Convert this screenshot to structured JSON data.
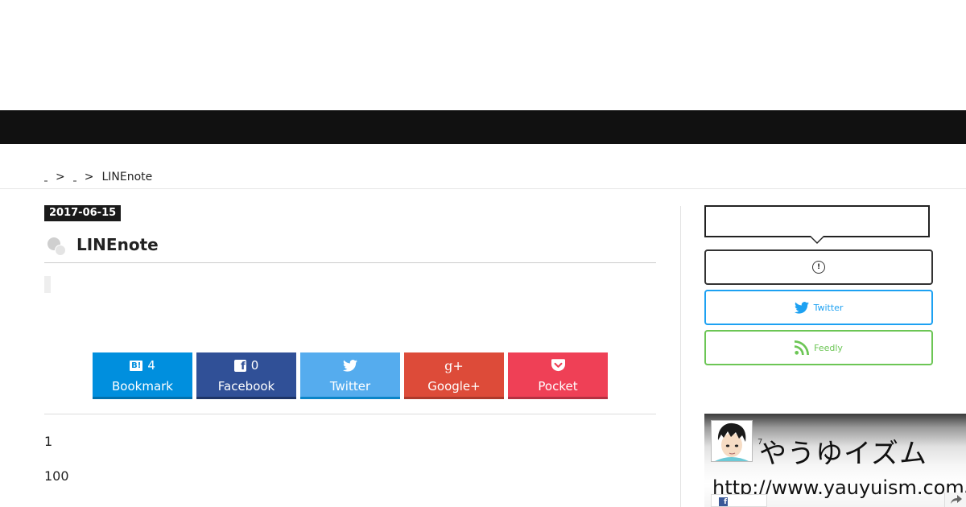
{
  "breadcrumb": {
    "separator": ">",
    "current": "LINEnote"
  },
  "post": {
    "date": "2017-06-15",
    "title": "LINEnote",
    "paragraphs": [
      "1",
      "100"
    ]
  },
  "share": {
    "hatena": {
      "badge": "B!",
      "count": "4",
      "label": "Bookmark",
      "color": "#008fde"
    },
    "facebook": {
      "badge": "f",
      "count": "0",
      "label": "Facebook",
      "color": "#305097"
    },
    "twitter": {
      "label": "Twitter",
      "color": "#55acee"
    },
    "gplus": {
      "badge": "g+",
      "label": "Google+",
      "color": "#dd4b39"
    },
    "pocket": {
      "label": "Pocket",
      "color": "#ef4056"
    }
  },
  "sidebar": {
    "follow_twitter": "Twitter",
    "follow_feedly": "Feedly",
    "twitter_color": "#1da1f2",
    "feedly_color": "#6cc655"
  },
  "banner": {
    "number": "7",
    "title": "やうゆイズム",
    "url": "http://www.yauyuism.com/",
    "fb_badge": "f"
  }
}
